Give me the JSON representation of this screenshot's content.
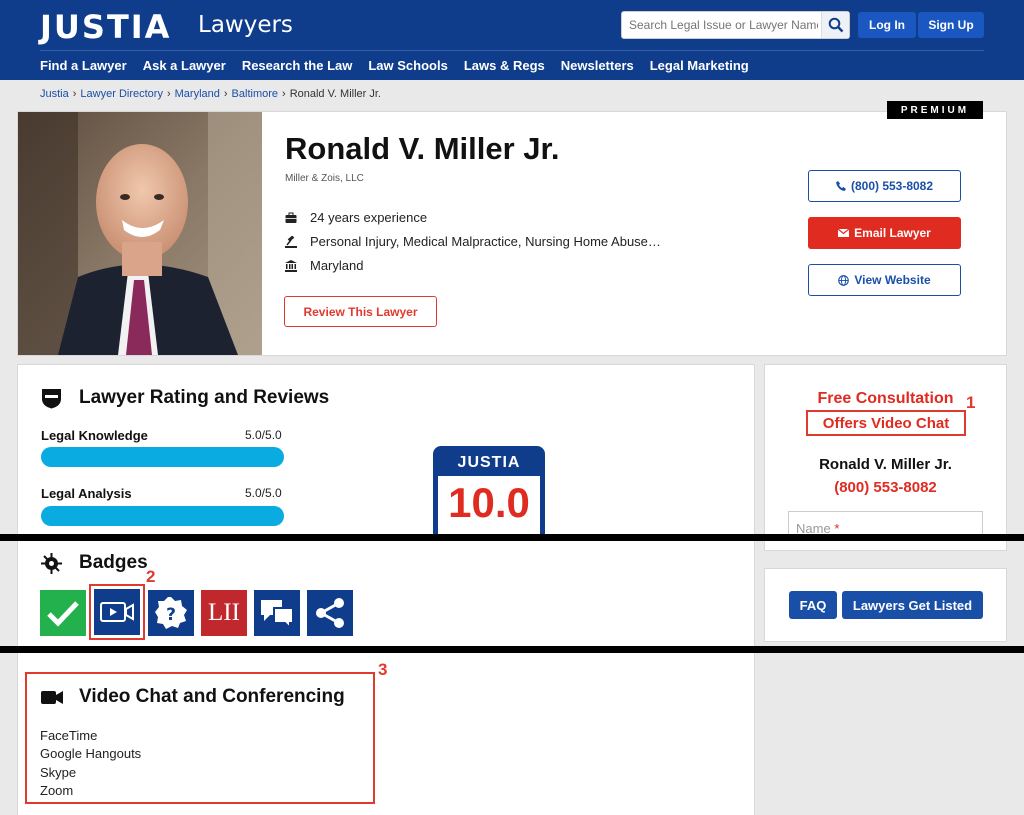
{
  "header": {
    "logo": "JUSTIA",
    "logo_sub": "Lawyers",
    "search_placeholder": "Search Legal Issue or Lawyer Name",
    "login": "Log In",
    "signup": "Sign Up",
    "nav": [
      "Find a Lawyer",
      "Ask a Lawyer",
      "Research the Law",
      "Law Schools",
      "Laws & Regs",
      "Newsletters",
      "Legal Marketing"
    ]
  },
  "breadcrumb": [
    "Justia",
    "Lawyer Directory",
    "Maryland",
    "Baltimore",
    "Ronald V. Miller Jr."
  ],
  "profile": {
    "premium": "PREMIUM",
    "name": "Ronald V. Miller Jr.",
    "firm": "Miller & Zois, LLC",
    "experience": "24 years experience",
    "practice": "Personal Injury, Medical Malpractice, Nursing Home Abuse…",
    "location": "Maryland",
    "review_btn": "Review This Lawyer",
    "phone_btn": "(800) 553-8082",
    "email_btn": "Email Lawyer",
    "website_btn": "View Website"
  },
  "rating": {
    "title": "Lawyer Rating and Reviews",
    "items": [
      {
        "label": "Legal Knowledge",
        "value": "5.0/5.0",
        "fraction": 1.0
      },
      {
        "label": "Legal Analysis",
        "value": "5.0/5.0",
        "fraction": 1.0
      }
    ],
    "score_label": "JUSTIA",
    "score_value": "10.0"
  },
  "sidebar": {
    "free_consult": "Free Consultation",
    "video_chat": "Offers Video Chat",
    "name": "Ronald V. Miller Jr.",
    "phone": "(800) 553-8082",
    "name_field": "Name",
    "required_mark": "*",
    "faq": "FAQ",
    "get_listed": "Lawyers Get Listed"
  },
  "badges": {
    "title": "Badges",
    "lii": "LII",
    "items": [
      "verified-check-icon",
      "video-chat-icon",
      "question-icon",
      "lii-icon",
      "chat-bubbles-icon",
      "share-icon"
    ]
  },
  "video": {
    "title": "Video Chat and Conferencing",
    "apps": [
      "FaceTime",
      "Google Hangouts",
      "Skype",
      "Zoom"
    ]
  },
  "annotations": [
    "1",
    "2",
    "3"
  ],
  "colors": {
    "brand_blue": "#0f3d8c",
    "accent_red": "#e02b20",
    "bar_cyan": "#0aabe1",
    "badge_green": "#22b14c",
    "badge_red": "#c0282d"
  }
}
